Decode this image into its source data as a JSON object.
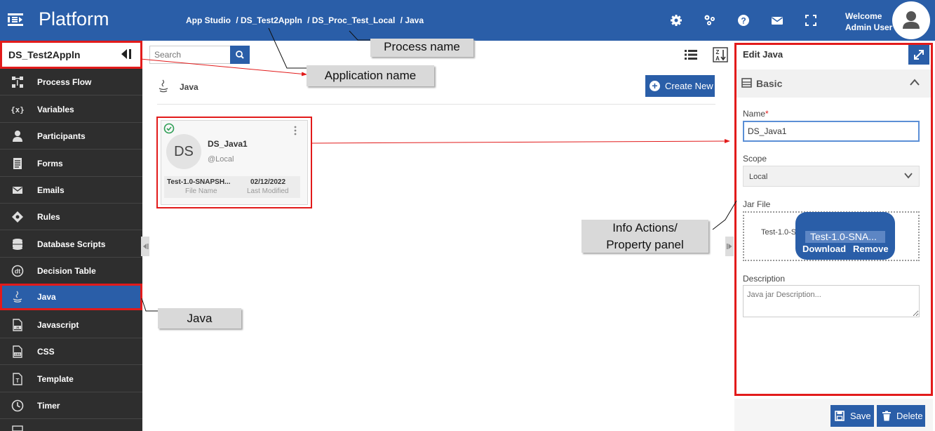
{
  "topbar": {
    "brand": "Platform",
    "breadcrumbs": [
      "App Studio",
      "/ DS_Test2Appln",
      "/ DS_Proc_Test_Local",
      "/ Java"
    ],
    "welcome_line1": "Welcome",
    "welcome_line2": "Admin User",
    "icons": [
      "gear-icon",
      "process-icon",
      "help-icon",
      "mail-icon",
      "fullscreen-icon"
    ]
  },
  "sidebar": {
    "app_name": "DS_Test2Appln",
    "items": [
      {
        "label": "Process Flow",
        "icon": "process-flow-icon"
      },
      {
        "label": "Variables",
        "icon": "variables-icon"
      },
      {
        "label": "Participants",
        "icon": "participants-icon"
      },
      {
        "label": "Forms",
        "icon": "forms-icon"
      },
      {
        "label": "Emails",
        "icon": "email-icon"
      },
      {
        "label": "Rules",
        "icon": "rules-icon"
      },
      {
        "label": "Database Scripts",
        "icon": "database-icon"
      },
      {
        "label": "Decision Table",
        "icon": "decision-table-icon"
      },
      {
        "label": "Java",
        "icon": "java-icon"
      },
      {
        "label": "Javascript",
        "icon": "javascript-icon"
      },
      {
        "label": "CSS",
        "icon": "css-icon"
      },
      {
        "label": "Template",
        "icon": "template-icon"
      },
      {
        "label": "Timer",
        "icon": "timer-icon"
      }
    ],
    "active_index": 8
  },
  "main": {
    "search_placeholder": "Search",
    "section_title": "Java",
    "create_label": "Create New",
    "card": {
      "initials": "DS",
      "title": "DS_Java1",
      "subtitle": "@Local",
      "file_value": "Test-1.0-SNAPSH...",
      "file_label": "File Name",
      "date_value": "02/12/2022",
      "date_label": "Last Modified"
    }
  },
  "panel": {
    "title": "Edit Java",
    "section": "Basic",
    "name_label": "Name",
    "name_required": "*",
    "name_value": "DS_Java1",
    "scope_label": "Scope",
    "scope_value": "Local",
    "jar_label": "Jar File",
    "jar_file": "Test-1.0-SNAPSHOT",
    "jar_tooltip": "Test-1.0-SNA...",
    "jar_download": "Download",
    "jar_remove": "Remove",
    "description_label": "Description",
    "description_placeholder": "Java jar Description...",
    "save_label": "Save",
    "delete_label": "Delete"
  },
  "annotations": {
    "process_name": "Process name",
    "application_name": "Application name",
    "java": "Java",
    "info_line1": "Info Actions/",
    "info_line2": "Property panel"
  },
  "colors": {
    "primary": "#2a5ea8",
    "sidebar": "#2e2e2e",
    "highlight": "#e21b1b",
    "callout": "#d9d9d9"
  }
}
